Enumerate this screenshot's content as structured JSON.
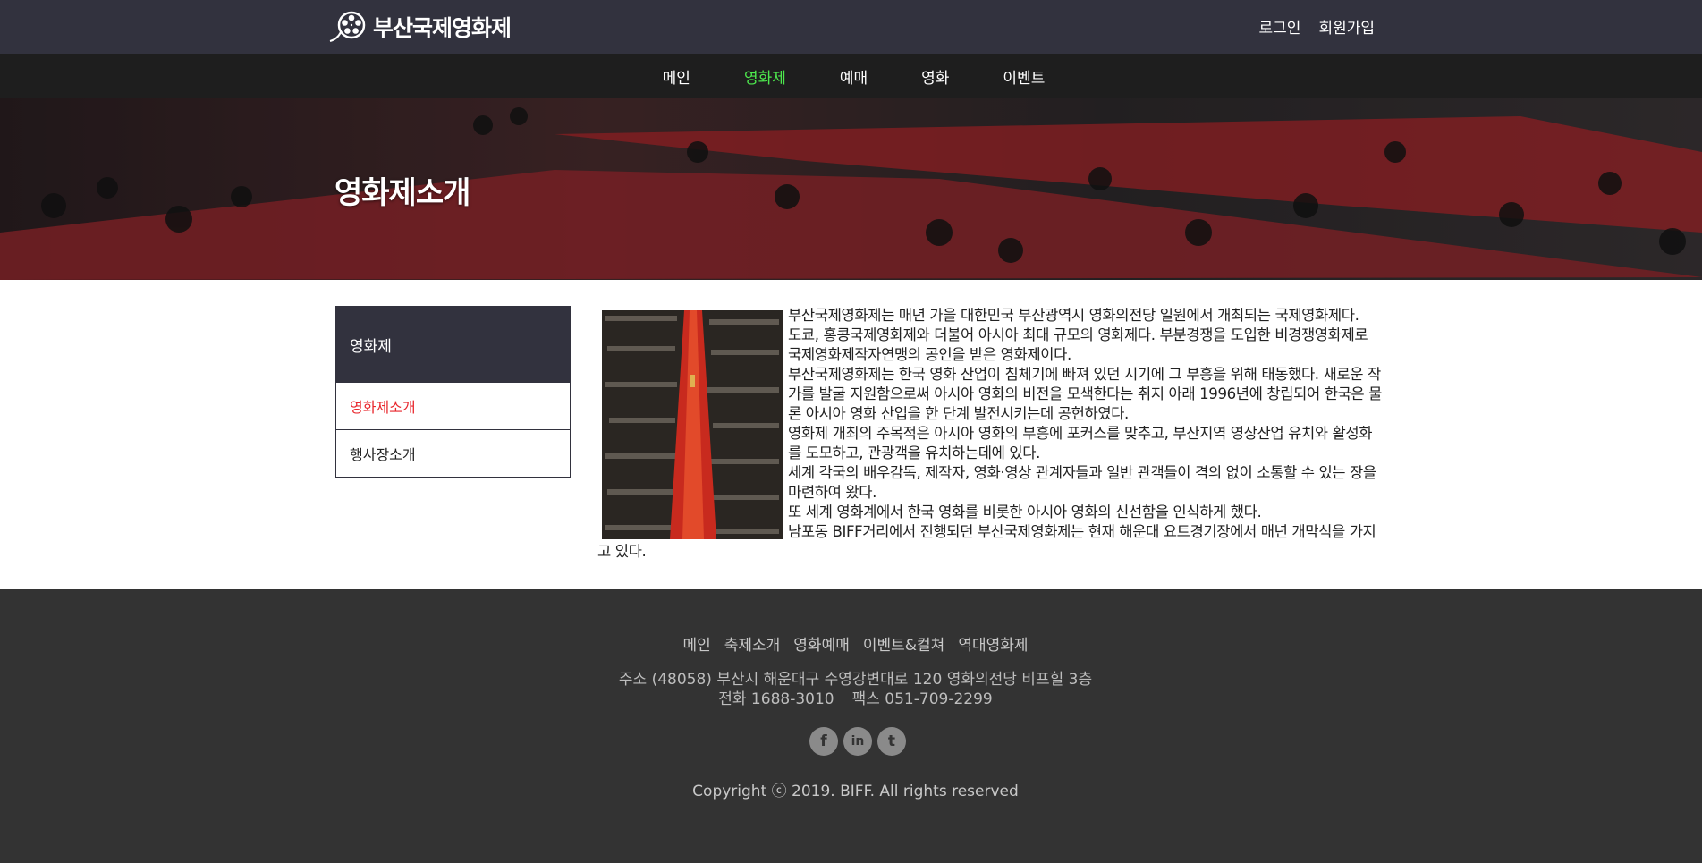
{
  "header": {
    "logo_text": "부산국제영화제",
    "login": "로그인",
    "signup": "회원가입"
  },
  "nav": {
    "items": [
      "메인",
      "영화제",
      "예매",
      "영화",
      "이벤트"
    ],
    "active": "영화제"
  },
  "hero": {
    "title": "영화제소개"
  },
  "sidebar": {
    "title": "영화제",
    "items": [
      {
        "label": "영화제소개",
        "active": true
      },
      {
        "label": "행사장소개",
        "active": false
      }
    ]
  },
  "article": {
    "paragraphs": [
      "부산국제영화제는 매년 가을 대한민국 부산광역시 영화의전당 일원에서 개최되는 국제영화제다.",
      "도쿄, 홍콩국제영화제와 더불어 아시아 최대 규모의 영화제다. 부분경쟁을 도입한 비경쟁영화제로 국제영화제작자연맹의 공인을 받은 영화제이다.",
      "부산국제영화제는 한국 영화 산업이 침체기에 빠져 있던 시기에 그 부흥을 위해 태동했다. 새로운 작가를 발굴 지원함으로써 아시아 영화의 비전을 모색한다는 취지 아래 1996년에 창립되어 한국은 물론 아시아 영화 산업을 한 단계 발전시키는데 공헌하였다.",
      "영화제 개최의 주목적은 아시아 영화의 부흥에 포커스를 맞추고, 부산지역 영상산업 유치와 활성화를 도모하고, 관광객을 유치하는데에 있다.",
      "세계 각국의 배우감독, 제작자, 영화·영상 관계자들과 일반 관객들이 격의 없이 소통할 수 있는 장을 마련하여 왔다.",
      "또 세계 영화계에서 한국 영화를 비롯한 아시아 영화의 신선함을 인식하게 했다.",
      "남포동 BIFF거리에서 진행되던 부산국제영화제는 현재 해운대 요트경기장에서 매년 개막식을 가지고 있다."
    ]
  },
  "footer": {
    "links": [
      "메인",
      "축제소개",
      "영화예매",
      "이벤트&컬쳐",
      "역대영화제"
    ],
    "address": "주소 (48058) 부산시 해운대구 수영강변대로 120 영화의전당 비프힐 3층",
    "phone": "전화 1688-3010",
    "fax": "팩스 051-709-2299",
    "social": [
      {
        "icon": "facebook-icon",
        "glyph": "f"
      },
      {
        "icon": "linkedin-icon",
        "glyph": "in"
      },
      {
        "icon": "twitter-icon",
        "glyph": "t"
      }
    ],
    "copyright": "Copyright ⓒ 2019. BIFF. All rights reserved"
  },
  "colors": {
    "header_bg": "#32323e",
    "nav_bg": "#1e1e1e",
    "nav_active": "#4de84d",
    "sidebar_active": "#e8262c",
    "footer_bg": "#333333"
  }
}
